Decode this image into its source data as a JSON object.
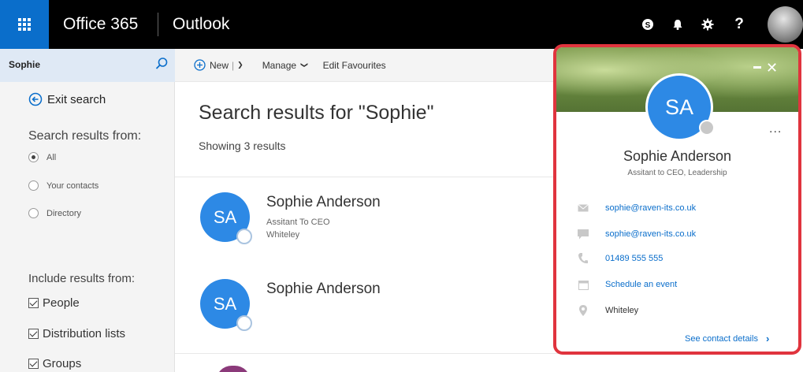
{
  "topbar": {
    "brand": "Office 365",
    "app_name": "Outlook",
    "icons": [
      "skype-icon",
      "bell-icon",
      "gear-icon",
      "help-icon"
    ],
    "help_label": "?"
  },
  "search": {
    "value": "Sophie"
  },
  "left_pane": {
    "exit_label": "Exit search",
    "results_from_label": "Search results from:",
    "scope_options": [
      {
        "label": "All",
        "selected": true
      },
      {
        "label": "Your contacts",
        "selected": false
      },
      {
        "label": "Directory",
        "selected": false
      }
    ],
    "include_label": "Include results from:",
    "include_options": [
      {
        "label": "People",
        "checked": true
      },
      {
        "label": "Distribution lists",
        "checked": true
      },
      {
        "label": "Groups",
        "checked": true
      }
    ]
  },
  "command_bar": {
    "new_label": "New",
    "manage_label": "Manage",
    "edit_favourites_label": "Edit Favourites"
  },
  "results": {
    "title": "Search results for \"Sophie\"",
    "count_text": "Showing 3 results",
    "items": [
      {
        "initials": "SA",
        "name": "Sophie Anderson",
        "title": "Assitant To CEO",
        "location": "Whiteley"
      },
      {
        "initials": "SA",
        "name": "Sophie Anderson"
      }
    ]
  },
  "contact_card": {
    "initials": "SA",
    "more_label": "...",
    "name": "Sophie Anderson",
    "subtitle": "Assitant to CEO, Leadership",
    "rows": [
      {
        "icon": "mail-icon",
        "text": "sophie@raven-its.co.uk",
        "link": true
      },
      {
        "icon": "chat-icon",
        "text": "sophie@raven-its.co.uk",
        "link": true
      },
      {
        "icon": "phone-icon",
        "text": "01489 555 555",
        "link": true
      },
      {
        "icon": "calendar-icon",
        "text": "Schedule an event",
        "link": true
      },
      {
        "icon": "location-icon",
        "text": "Whiteley",
        "link": false
      }
    ],
    "details_label": "See contact details"
  },
  "colors": {
    "accent": "#0a6ecb",
    "persona_blue": "#2d89e5",
    "highlight_border": "#e0343e",
    "topbar": "#000000"
  }
}
